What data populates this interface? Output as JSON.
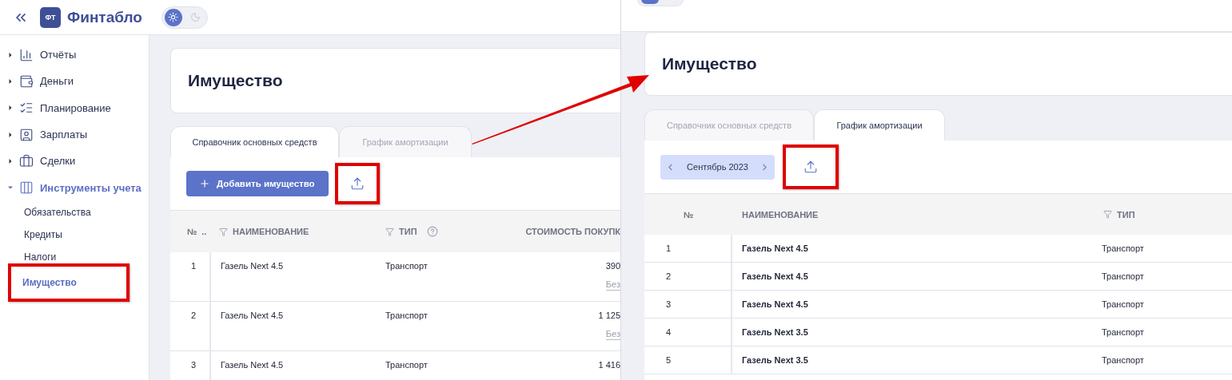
{
  "left_window": {
    "header": {
      "logo_mark": "ФТ",
      "brand": "Финтабло",
      "theme_options": [
        {
          "kind": "sun",
          "selected": true
        },
        {
          "kind": "moon",
          "selected": false
        }
      ]
    },
    "sidebar": {
      "items": [
        {
          "label": "Отчёты",
          "kind": "chart",
          "expanded": false
        },
        {
          "label": "Деньги",
          "kind": "wallet",
          "expanded": false
        },
        {
          "label": "Планирование",
          "kind": "checklist",
          "expanded": false
        },
        {
          "label": "Зарплаты",
          "kind": "person",
          "expanded": false
        },
        {
          "label": "Сделки",
          "kind": "briefcase",
          "expanded": false
        },
        {
          "label": "Инструменты учета",
          "kind": "table",
          "expanded": true,
          "children": [
            {
              "label": "Обязательства",
              "selected": false,
              "highlighted": false
            },
            {
              "label": "Кредиты",
              "selected": false,
              "highlighted": false
            },
            {
              "label": "Налоги",
              "selected": false,
              "highlighted": false
            },
            {
              "label": "Имущество",
              "selected": true,
              "highlighted": true
            }
          ]
        }
      ]
    },
    "page_title": "Имущество",
    "tabs": [
      {
        "label": "Справочник основных средств",
        "selected": true
      },
      {
        "label": "График амортизации",
        "selected": false
      }
    ],
    "add_button": {
      "label": "Добавить имущество"
    },
    "export_button": {
      "highlighted": true
    },
    "table": {
      "columns": [
        {
          "label": "№",
          "filter": false,
          "help": false
        },
        {
          "label": "..",
          "filter": false,
          "help": false
        },
        {
          "label": "НАИМЕНОВАНИЕ",
          "filter": true,
          "help": false
        },
        {
          "label": "ТИП",
          "filter": true,
          "help": true
        },
        {
          "label": "СТОИМОСТЬ ПОКУПК",
          "filter": false,
          "help": false
        }
      ],
      "rows": [
        {
          "number": "1",
          "name": "Газель Next 4.5",
          "type": "Транспорт",
          "cost": "390",
          "cost_note": "Без"
        },
        {
          "number": "2",
          "name": "Газель Next 4.5",
          "type": "Транспорт",
          "cost": "1 125",
          "cost_note": "Без"
        },
        {
          "number": "3",
          "name": "Газель Next 4.5",
          "type": "Транспорт",
          "cost": "1 416"
        }
      ]
    }
  },
  "right_window": {
    "page_title": "Имущество",
    "tabs": [
      {
        "label": "Справочник основных средств",
        "selected": false
      },
      {
        "label": "График амортизации",
        "selected": true
      }
    ],
    "month_picker": {
      "label": "Сентябрь 2023"
    },
    "export_button": {
      "highlighted": true
    },
    "table": {
      "columns": [
        {
          "label": "№",
          "filter": false
        },
        {
          "label": "НАИМЕНОВАНИЕ",
          "filter": false
        },
        {
          "label": "ТИП",
          "filter": true
        }
      ],
      "rows": [
        {
          "number": "1",
          "name": "Газель Next 4.5",
          "type": "Транспорт"
        },
        {
          "number": "2",
          "name": "Газель Next 4.5",
          "type": "Транспорт"
        },
        {
          "number": "3",
          "name": "Газель Next 4.5",
          "type": "Транспорт"
        },
        {
          "number": "4",
          "name": "Газель Next 3.5",
          "type": "Транспорт"
        },
        {
          "number": "5",
          "name": "Газель Next 3.5",
          "type": "Транспорт"
        }
      ]
    }
  }
}
